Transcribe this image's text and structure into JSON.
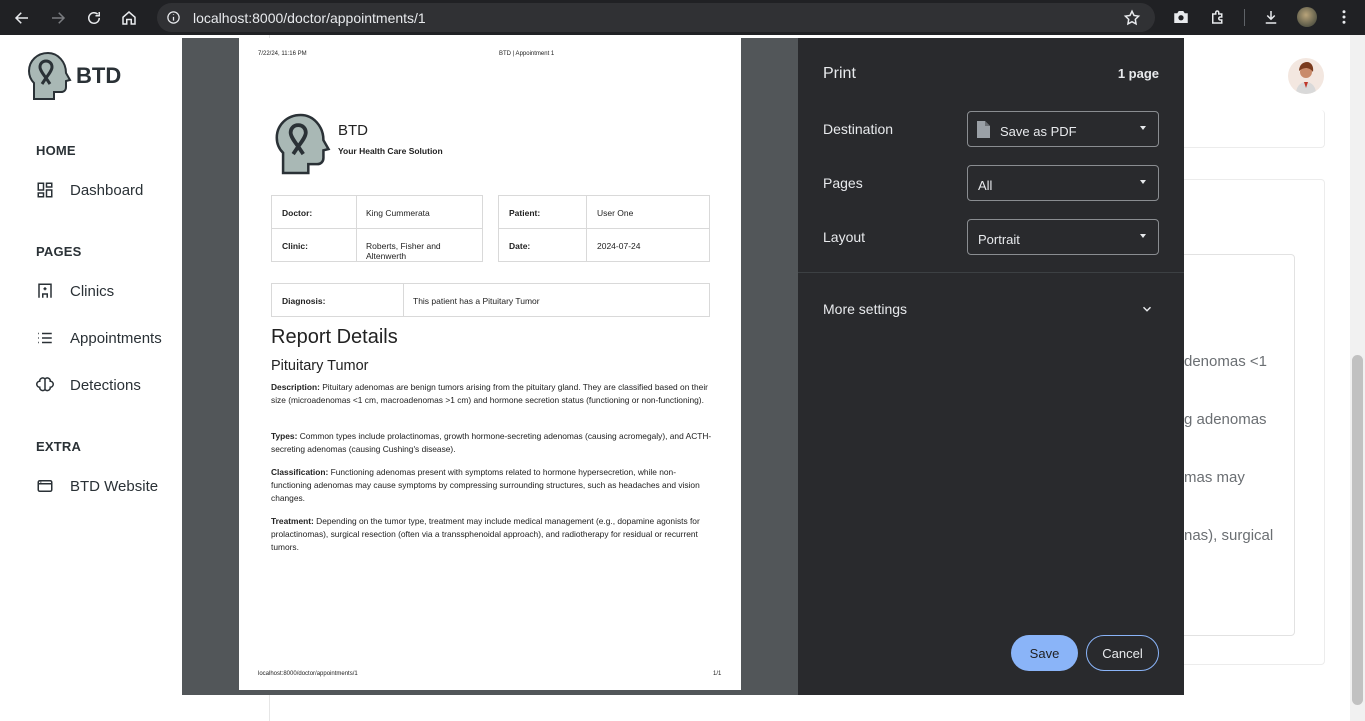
{
  "browser": {
    "url": "localhost:8000/doctor/appointments/1",
    "icons": [
      "back-icon",
      "forward-icon",
      "reload-icon",
      "home-icon",
      "site-info-icon",
      "bookmark-star-icon",
      "screenshot-icon",
      "extensions-icon",
      "download-icon",
      "profile-avatar",
      "menu-icon"
    ]
  },
  "sidebar": {
    "brand": "BTD",
    "sections": [
      {
        "title": "HOME",
        "items": [
          {
            "label": "Dashboard",
            "icon": "dashboard-icon"
          }
        ]
      },
      {
        "title": "PAGES",
        "items": [
          {
            "label": "Clinics",
            "icon": "clinic-icon"
          },
          {
            "label": "Appointments",
            "icon": "list-icon"
          },
          {
            "label": "Detections",
            "icon": "brain-icon"
          }
        ]
      },
      {
        "title": "EXTRA",
        "items": [
          {
            "label": "BTD Website",
            "icon": "browser-window-icon"
          }
        ]
      }
    ]
  },
  "background_fragments": [
    "denomas <1",
    "g adenomas",
    "mas may",
    "nas), surgical"
  ],
  "print": {
    "title": "Print",
    "page_count": "1 page",
    "destination_label": "Destination",
    "destination_value": "Save as PDF",
    "pages_label": "Pages",
    "pages_value": "All",
    "layout_label": "Layout",
    "layout_value": "Portrait",
    "more_settings": "More settings",
    "save": "Save",
    "cancel": "Cancel"
  },
  "preview": {
    "date_header": "7/22/24, 11:16 PM",
    "title_header": "BTD | Appointment 1",
    "footer_url": "localhost:8000/doctor/appointments/1",
    "footer_page": "1/1",
    "brand": "BTD",
    "tagline": "Your Health Care Solution",
    "doctor_label": "Doctor:",
    "doctor": "King Cummerata",
    "clinic_label": "Clinic:",
    "clinic": "Roberts, Fisher and Altenwerth",
    "patient_label": "Patient:",
    "patient": "User One",
    "date_label": "Date:",
    "date": "2024-07-24",
    "diagnosis_label": "Diagnosis:",
    "diagnosis": "This patient has a Pituitary Tumor",
    "report_heading": "Report Details",
    "tumor_heading": "Pituitary Tumor",
    "description_label": "Description:",
    "description": " Pituitary adenomas are benign tumors arising from the pituitary gland. They are classified based on their size (microadenomas <1 cm, macroadenomas >1 cm) and hormone secretion status (functioning or non-functioning).",
    "types_label": "Types:",
    "types": " Common types include prolactinomas, growth hormone-secreting adenomas (causing acromegaly), and ACTH-secreting adenomas (causing Cushing's disease).",
    "classification_label": "Classification:",
    "classification": " Functioning adenomas present with symptoms related to hormone hypersecretion, while non-functioning adenomas may cause symptoms by compressing surrounding structures, such as headaches and vision changes.",
    "treatment_label": "Treatment:",
    "treatment": " Depending on the tumor type, treatment may include medical management (e.g., dopamine agonists for prolactinomas), surgical resection (often via a transsphenoidal approach), and radiotherapy for residual or recurrent tumors."
  }
}
